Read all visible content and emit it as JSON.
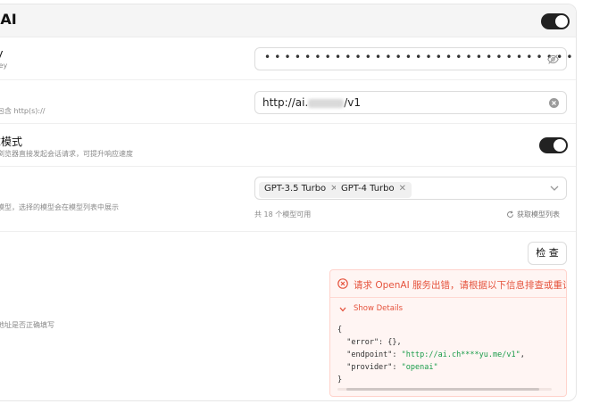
{
  "header": {
    "title": "nAI",
    "enabled": true
  },
  "api_key": {
    "label": "ey",
    "description": "l Key",
    "masked_value": "••••••••••••••••••••••••••••••••••••••••••••"
  },
  "proxy": {
    "description": "须包含 http(s)://",
    "value_prefix": "http://ai.",
    "value_suffix": "/v1"
  },
  "client_mode": {
    "label": "求模式",
    "description": "从浏览器直接发起会话请求，可提升响应速度",
    "enabled": true
  },
  "models": {
    "description": "的模型，选择的模型会在模型列表中展示",
    "tags": [
      "GPT-3.5 Turbo",
      "GPT-4 Turbo"
    ],
    "count_text": "共 18 个模型可用",
    "fetch_label": "获取模型列表"
  },
  "check": {
    "button_label": "检 查",
    "description": "理地址是否正确填写"
  },
  "error": {
    "title": "请求 OpenAI 服务出错，请根据以下信息排查或重试",
    "details_label": "Show Details",
    "code": {
      "line1": "{",
      "error_line": "  \"error\": {},",
      "endpoint_key": "  \"endpoint\": ",
      "endpoint_value": "\"http://ai.ch****yu.me/v1\"",
      "endpoint_end": ",",
      "provider_key": "  \"provider\": ",
      "provider_value": "\"openai\"",
      "line_end": "}"
    }
  },
  "colors": {
    "accent": "#222222",
    "error": "#e5533d",
    "string": "#1a9c4a"
  }
}
